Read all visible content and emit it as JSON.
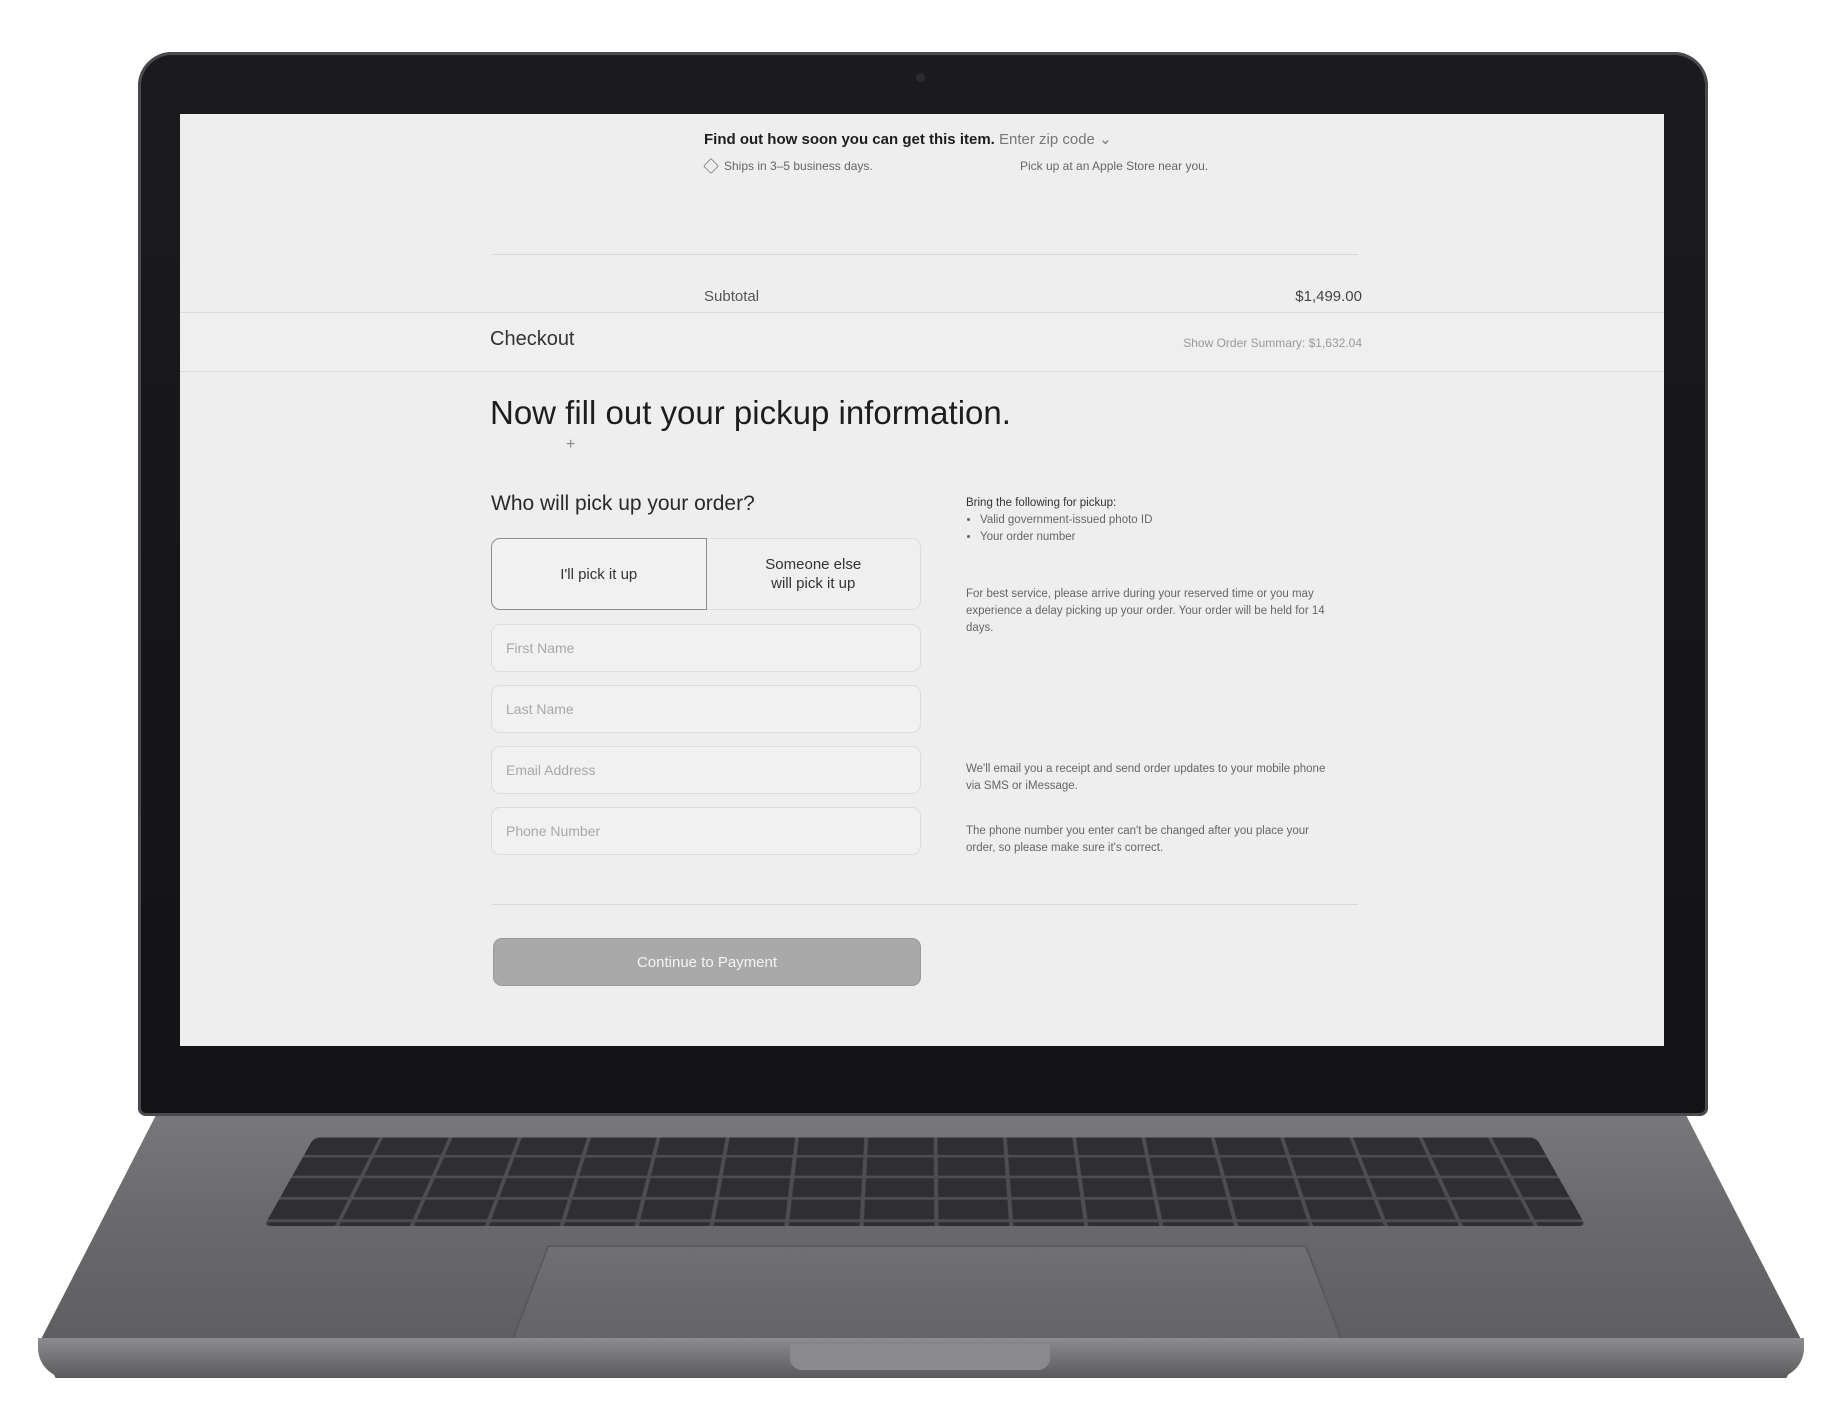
{
  "delivery": {
    "prompt": "Find out how soon you can get this item.",
    "zip_link": "Enter zip code",
    "chevron": "⌄",
    "ships_icon": "box-icon",
    "ships": "Ships in 3–5 business days.",
    "pickup": "Pick up at an Apple Store near you."
  },
  "subtotal": {
    "label": "Subtotal",
    "value": "$1,499.00"
  },
  "checkout": {
    "title": "Checkout",
    "order_summary": "Show Order Summary: $1,632.04"
  },
  "form": {
    "headline": "Now fill out your pickup information.",
    "plus": "+",
    "question": "Who will pick up your order?",
    "options": [
      {
        "label": "I'll pick it up",
        "selected": true
      },
      {
        "label": "Someone else will pick it up",
        "selected": false
      }
    ],
    "fields": [
      {
        "placeholder": "First Name",
        "value": ""
      },
      {
        "placeholder": "Last Name",
        "value": ""
      },
      {
        "placeholder": "Email Address",
        "value": ""
      },
      {
        "placeholder": "Phone Number",
        "value": ""
      }
    ],
    "continue_label": "Continue to Payment"
  },
  "info": {
    "bring_title": "Bring the following for pickup:",
    "bring_items": [
      "Valid government-issued photo ID",
      "Your order number"
    ],
    "best_service": "For best service, please arrive during your reserved time or you may experience a delay picking up your order. Your order will be held for 14 days.",
    "email_note": "We'll email you a receipt and send order updates to your mobile phone via SMS or iMessage.",
    "phone_note": "The phone number you enter can't be changed after you place your order, so please make sure it's correct."
  }
}
